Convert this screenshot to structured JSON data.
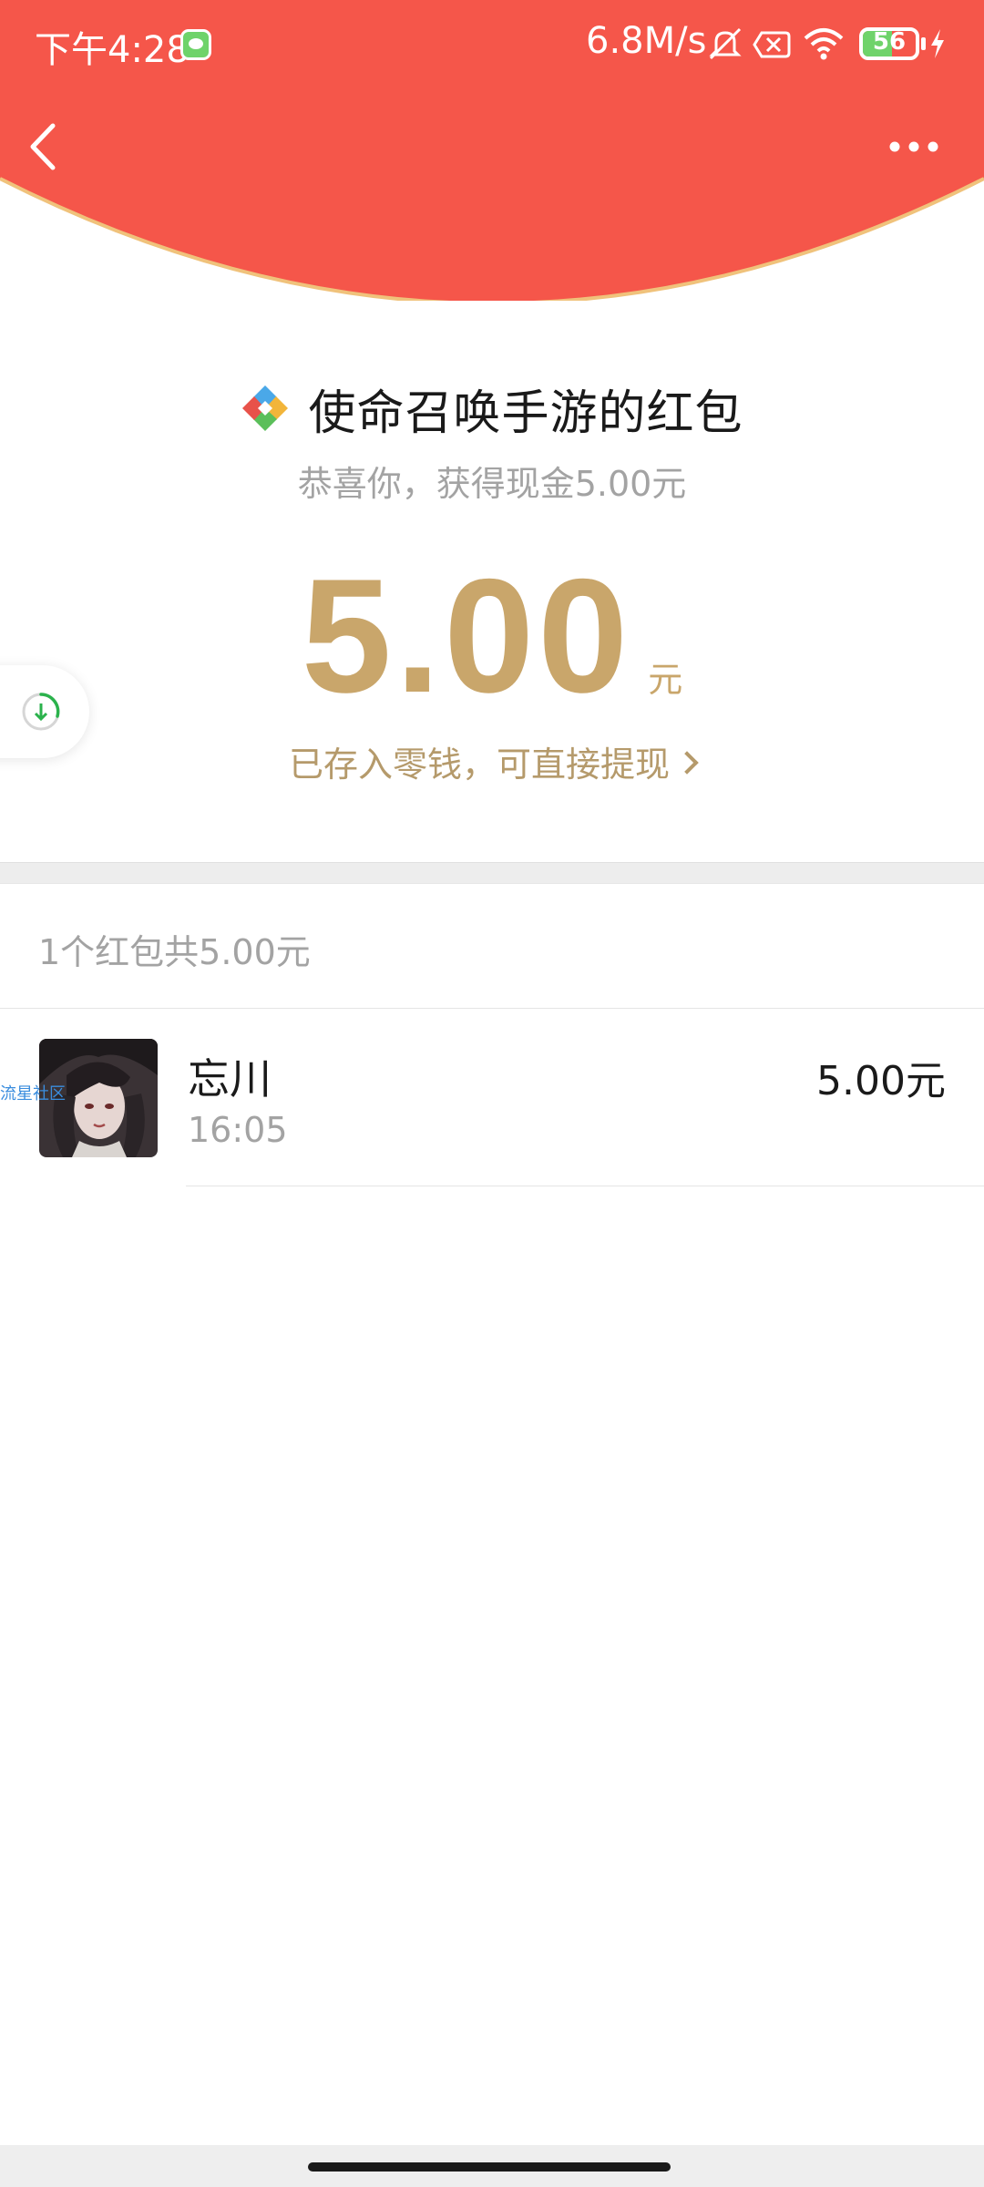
{
  "status_bar": {
    "time": "下午4:28",
    "network_speed": "6.8M/s",
    "battery_level": "56",
    "battery_fraction": 0.56
  },
  "colors": {
    "header_red": "#f5564a",
    "header_edge": "#f0c27b",
    "amount_gold": "#c9a66b",
    "link_gold": "#b59a6b"
  },
  "header": {
    "back_icon": "chevron-left-icon",
    "more_icon": "more-dots-icon"
  },
  "envelope": {
    "title": "使命召唤手游的红包",
    "subtitle": "恭喜你，获得现金5.00元",
    "amount": "5.00",
    "unit": "元",
    "saved_link": "已存入零钱，可直接提现"
  },
  "summary": "1个红包共5.00元",
  "receivers": [
    {
      "name": "忘川",
      "time": "16:05",
      "amount": "5.00元",
      "avatar_watermark": "流星社区"
    }
  ]
}
